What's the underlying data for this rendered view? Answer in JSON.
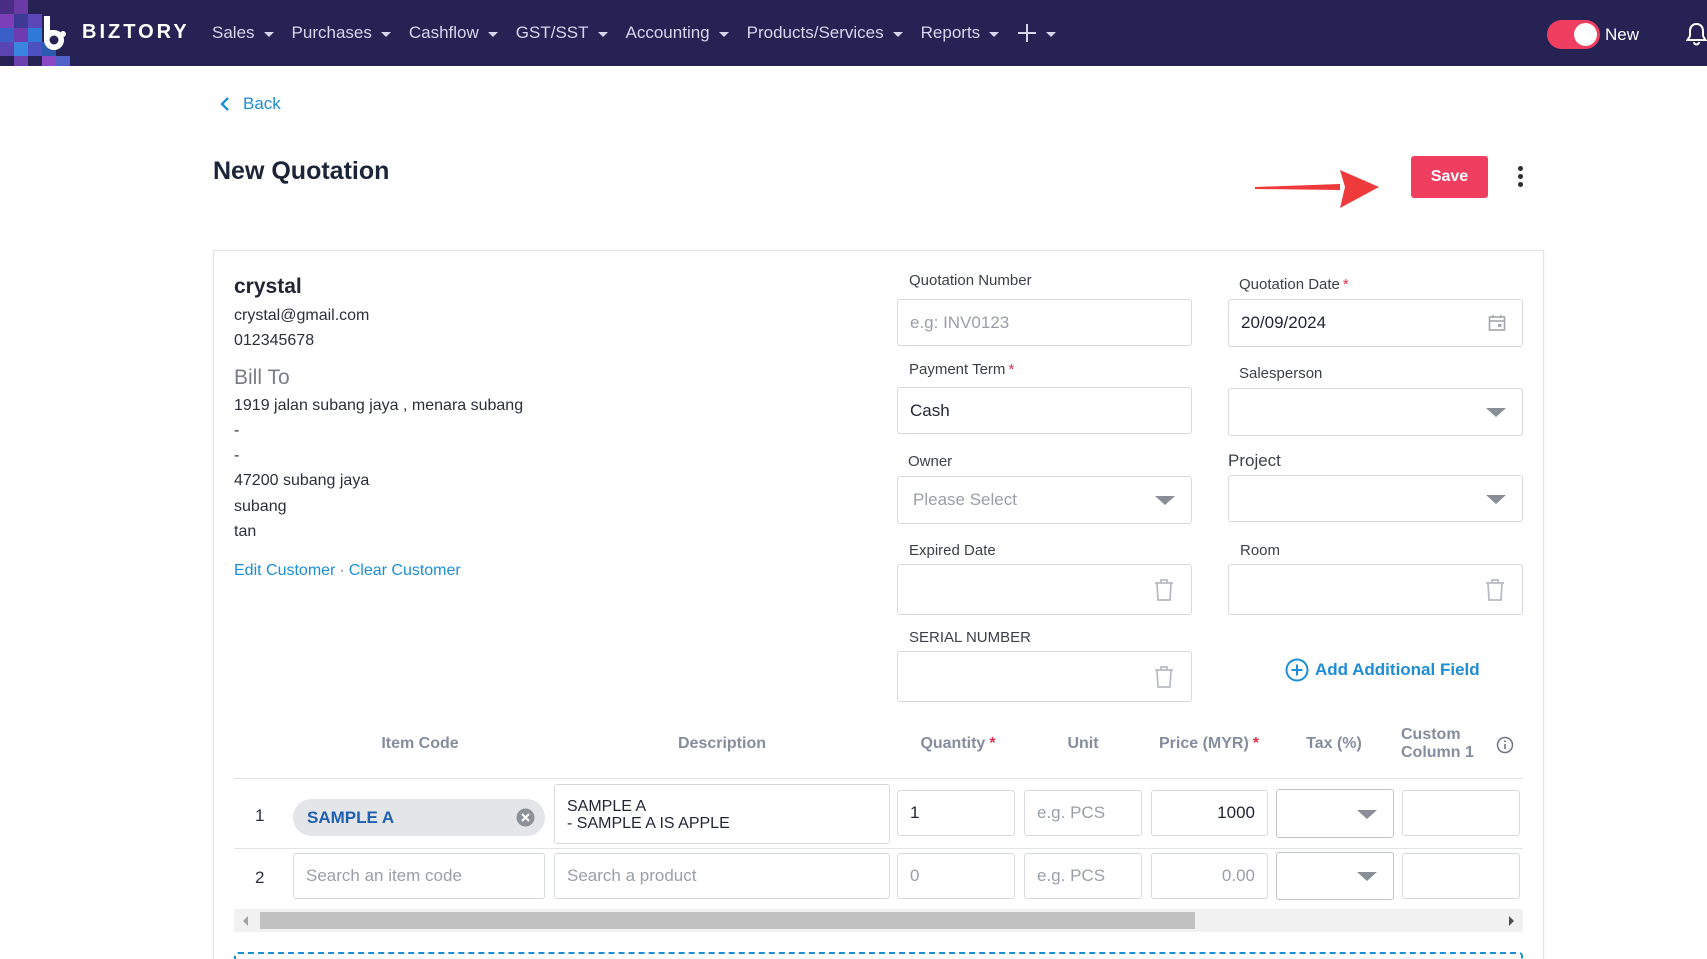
{
  "app": {
    "brand": "BIZTORY"
  },
  "nav": {
    "items": [
      {
        "label": "Sales"
      },
      {
        "label": "Purchases"
      },
      {
        "label": "Cashflow"
      },
      {
        "label": "GST/SST"
      },
      {
        "label": "Accounting"
      },
      {
        "label": "Products/Services"
      },
      {
        "label": "Reports"
      }
    ],
    "plus_icon": "plus-icon",
    "toggle_label": "New",
    "toggle_on": true,
    "bell_icon": "bell-icon"
  },
  "header": {
    "back_label": "Back",
    "title": "New Quotation",
    "save_label": "Save"
  },
  "customer": {
    "name": "crystal",
    "email": "crystal@gmail.com",
    "phone": "012345678",
    "bill_to_label": "Bill To",
    "address": [
      "1919 jalan subang jaya , menara subang",
      "-",
      "-",
      "47200 subang jaya",
      "subang",
      "tan"
    ],
    "edit_label": "Edit Customer",
    "separator": "·",
    "clear_label": "Clear Customer"
  },
  "form": {
    "quotation_number": {
      "label": "Quotation Number",
      "placeholder": "e.g: INV0123"
    },
    "quotation_date": {
      "label": "Quotation Date",
      "value": "20/09/2024"
    },
    "payment_term": {
      "label": "Payment Term",
      "value": "Cash"
    },
    "salesperson": {
      "label": "Salesperson",
      "value": ""
    },
    "owner": {
      "label": "Owner",
      "placeholder": "Please Select"
    },
    "project": {
      "label": "Project",
      "value": ""
    },
    "expired_date": {
      "label": "Expired Date",
      "value": ""
    },
    "room": {
      "label": "Room",
      "value": ""
    },
    "serial_number": {
      "label": "SERIAL NUMBER",
      "value": ""
    },
    "add_field_label": "Add Additional Field",
    "required_mark": "*"
  },
  "table": {
    "headers": {
      "item_code": "Item Code",
      "description": "Description",
      "quantity": "Quantity",
      "unit": "Unit",
      "price": "Price (MYR)",
      "tax": "Tax (%)",
      "custom1_a": "Custom",
      "custom1_b": "Column 1"
    },
    "rows": [
      {
        "num": "1",
        "item_code": "SAMPLE A",
        "description_line1": "SAMPLE A",
        "description_line2": "- SAMPLE A IS APPLE",
        "quantity": "1",
        "unit_placeholder": "e.g. PCS",
        "price": "1000",
        "tax": "",
        "custom1": ""
      },
      {
        "num": "2",
        "item_code_placeholder": "Search an item code",
        "description_placeholder": "Search a product",
        "quantity_placeholder": "0",
        "unit_placeholder": "e.g. PCS",
        "price_placeholder": "0.00",
        "tax": "",
        "custom1": ""
      }
    ]
  },
  "colors": {
    "navbar_bg": "#262254",
    "accent_pink": "#ef3e5f",
    "link_blue": "#1d8ed6",
    "chip_text": "#1e5fb0"
  }
}
